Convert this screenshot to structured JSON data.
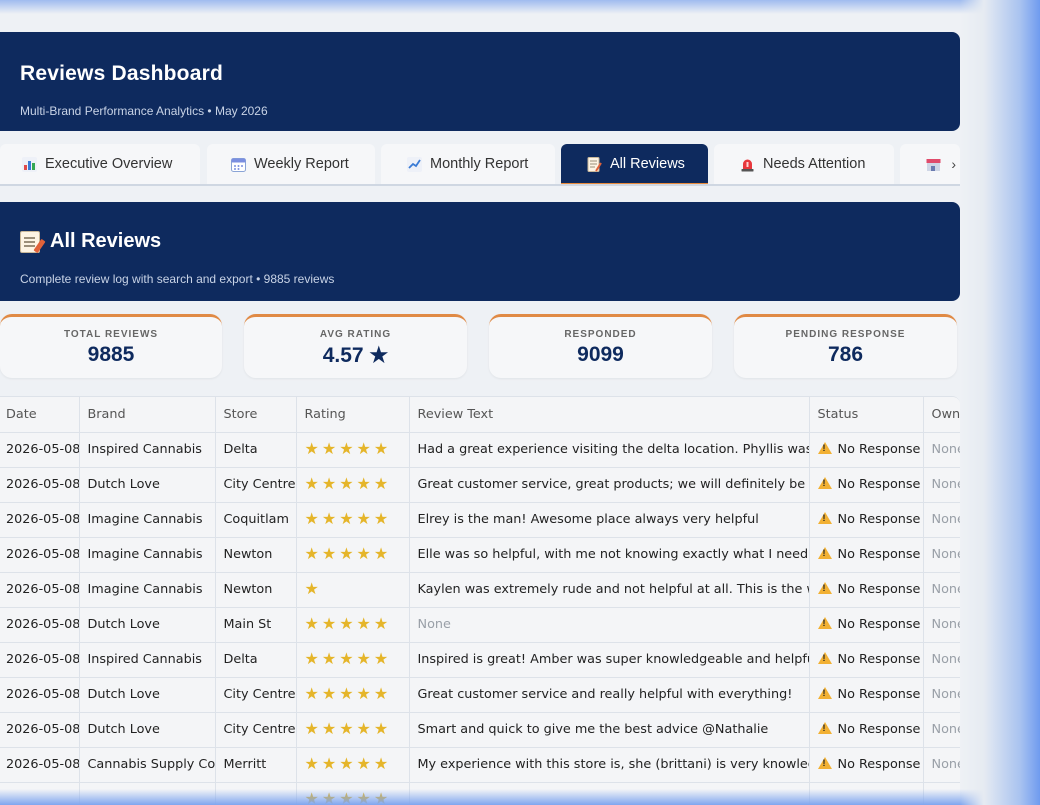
{
  "header": {
    "title": "Reviews Dashboard",
    "subtitle": "Multi-Brand Performance Analytics • May 2026"
  },
  "tabs": [
    {
      "icon": "bar-chart-icon",
      "label": "Executive Overview"
    },
    {
      "icon": "calendar-icon",
      "label": "Weekly Report"
    },
    {
      "icon": "trend-chart-icon",
      "label": "Monthly Report"
    },
    {
      "icon": "memo-icon",
      "label": "All Reviews",
      "active": true
    },
    {
      "icon": "siren-icon",
      "label": "Needs Attention"
    },
    {
      "icon": "store-icon",
      "label": ""
    }
  ],
  "section": {
    "title": "All Reviews",
    "subtitle": "Complete review log with search and export • 9885 reviews"
  },
  "stats": [
    {
      "label": "TOTAL REVIEWS",
      "value": "9885"
    },
    {
      "label": "AVG RATING",
      "value": "4.57 ★"
    },
    {
      "label": "RESPONDED",
      "value": "9099"
    },
    {
      "label": "PENDING RESPONSE",
      "value": "786"
    }
  ],
  "table": {
    "columns": [
      "Date",
      "Brand",
      "Store",
      "Rating",
      "Review Text",
      "Status",
      "Owner"
    ],
    "rows": [
      {
        "date": "2026-05-08",
        "brand": "Inspired Cannabis",
        "store": "Delta",
        "rating": 5,
        "text": "Had a great experience visiting the delta location. Phyllis was able to",
        "status": "No Response",
        "owner": "None"
      },
      {
        "date": "2026-05-08",
        "brand": "Dutch Love",
        "store": "City Centre",
        "rating": 5,
        "text": "Great customer service, great products; we will definitely be back!",
        "status": "No Response",
        "owner": "None"
      },
      {
        "date": "2026-05-08",
        "brand": "Imagine Cannabis",
        "store": "Coquitlam",
        "rating": 5,
        "text": "Elrey is the man! Awesome place always very helpful",
        "status": "No Response",
        "owner": "None"
      },
      {
        "date": "2026-05-08",
        "brand": "Imagine Cannabis",
        "store": "Newton",
        "rating": 5,
        "text": "Elle was so helpful, with me not knowing exactly what I need, but she",
        "status": "No Response",
        "owner": "None"
      },
      {
        "date": "2026-05-08",
        "brand": "Imagine Cannabis",
        "store": "Newton",
        "rating": 1,
        "text": "Kaylen was extremely rude and not helpful at all. This is the worst in",
        "status": "No Response",
        "owner": "None"
      },
      {
        "date": "2026-05-08",
        "brand": "Dutch Love",
        "store": "Main St",
        "rating": 5,
        "text": "None",
        "status": "No Response",
        "owner": "None"
      },
      {
        "date": "2026-05-08",
        "brand": "Inspired Cannabis",
        "store": "Delta",
        "rating": 5,
        "text": "Inspired is great! Amber was super knowledgeable and helpful",
        "status": "No Response",
        "owner": "None"
      },
      {
        "date": "2026-05-08",
        "brand": "Dutch Love",
        "store": "City Centre",
        "rating": 5,
        "text": "Great customer service and really helpful with everything!",
        "status": "No Response",
        "owner": "None"
      },
      {
        "date": "2026-05-08",
        "brand": "Dutch Love",
        "store": "City Centre",
        "rating": 5,
        "text": "Smart and quick to give me the best advice @Nathalie",
        "status": "No Response",
        "owner": "None"
      },
      {
        "date": "2026-05-08",
        "brand": "Cannabis Supply Co.",
        "store": "Merritt",
        "rating": 5,
        "text": "My experience with this store is, she (brittani) is very knowledgable",
        "status": "No Response",
        "owner": "None"
      },
      {
        "date": "",
        "brand": "",
        "store": "",
        "rating": 5,
        "text": "",
        "status": "",
        "owner": ""
      }
    ]
  }
}
